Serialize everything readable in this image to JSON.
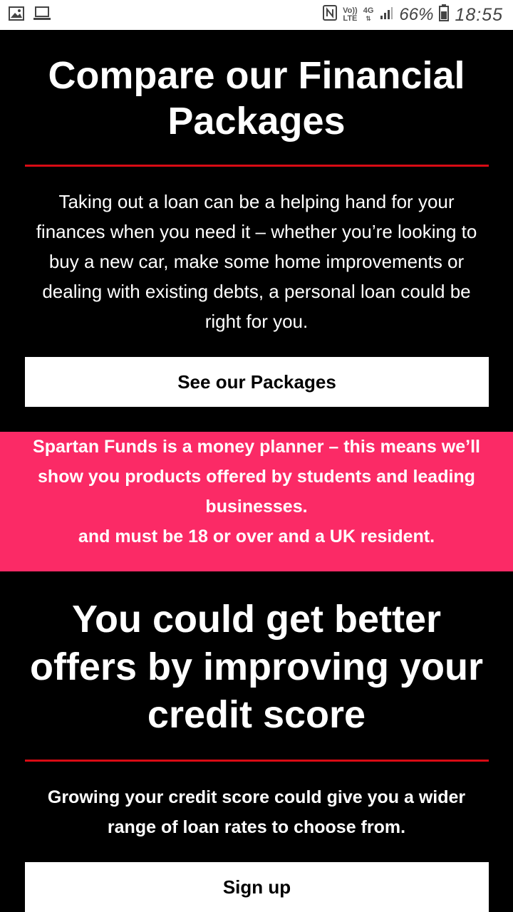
{
  "status_bar": {
    "left_icons": [
      "image-icon",
      "laptop-icon"
    ],
    "volte_top": "Vo))",
    "volte_bottom": "LTE",
    "network": "4G",
    "battery_percent": "66%",
    "time": "18:55"
  },
  "financial": {
    "title": "Compare our Financial Packages",
    "intro": "Taking out a loan can be a helping hand for your finances when you need it – whether you’re looking to buy a new car, make some home improvements or dealing with existing debts, a personal loan could be right for you.",
    "button_label": "See our Packages"
  },
  "notice": {
    "line1": "Spartan Funds is a money planner – this means we’ll show you products offered by students and leading businesses.",
    "line2": "and must be 18 or over and a UK resident."
  },
  "credit": {
    "title": "You could get better offers by improving your credit score",
    "text": "Growing your credit score could give you a wider range of loan rates to choose from.",
    "button_label": "Sign up"
  },
  "colors": {
    "background": "#000000",
    "accent_red": "#d80b14",
    "notice_pink": "#fb2a66",
    "button_bg": "#ffffff"
  }
}
